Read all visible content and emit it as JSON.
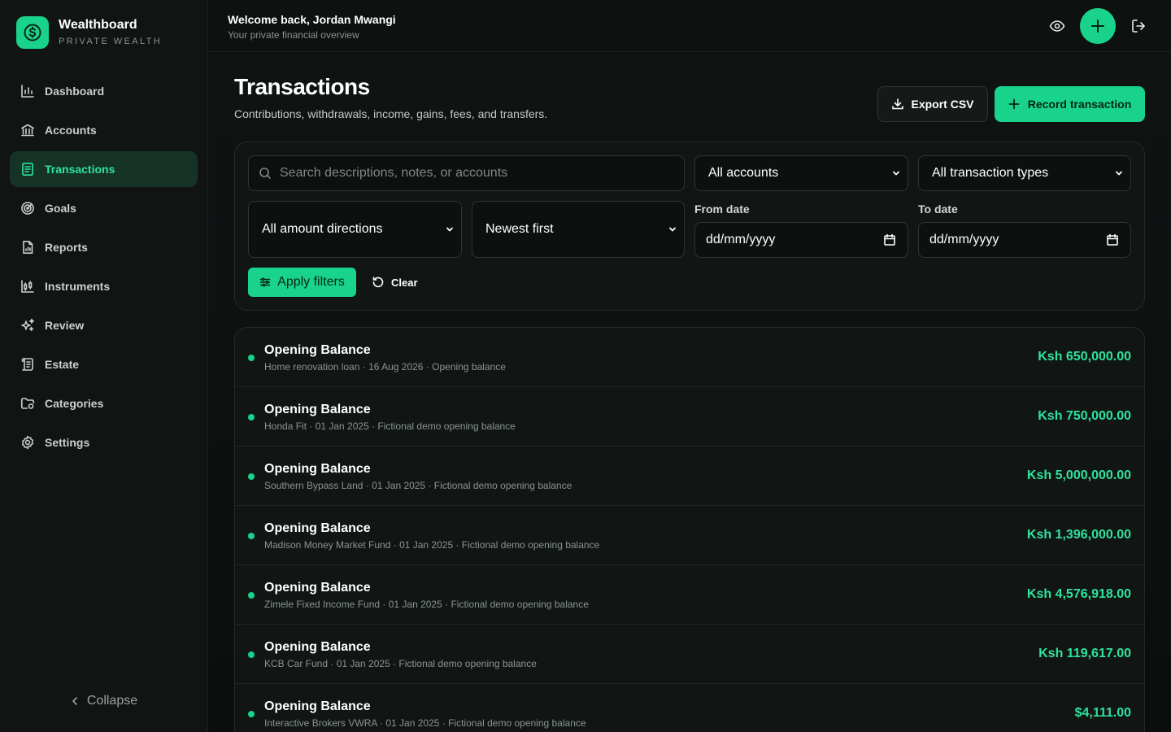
{
  "brand": {
    "name": "Wealthboard",
    "subtitle": "PRIVATE WEALTH"
  },
  "sidebar": {
    "items": [
      {
        "label": "Dashboard",
        "icon": "bar-chart-icon",
        "active": false
      },
      {
        "label": "Accounts",
        "icon": "bank-icon",
        "active": false
      },
      {
        "label": "Transactions",
        "icon": "receipt-icon",
        "active": true
      },
      {
        "label": "Goals",
        "icon": "target-icon",
        "active": false
      },
      {
        "label": "Reports",
        "icon": "report-icon",
        "active": false
      },
      {
        "label": "Instruments",
        "icon": "candlestick-icon",
        "active": false
      },
      {
        "label": "Review",
        "icon": "sparkles-icon",
        "active": false
      },
      {
        "label": "Estate",
        "icon": "scroll-icon",
        "active": false
      },
      {
        "label": "Categories",
        "icon": "folder-icon",
        "active": false
      },
      {
        "label": "Settings",
        "icon": "gear-icon",
        "active": false
      }
    ],
    "collapse_label": "Collapse"
  },
  "header": {
    "welcome": "Welcome back, Jordan Mwangi",
    "subtitle": "Your private financial overview"
  },
  "page": {
    "title": "Transactions",
    "subtitle": "Contributions, withdrawals, income, gains, fees, and transfers.",
    "export_label": "Export CSV",
    "record_label": "Record transaction"
  },
  "filters": {
    "search_placeholder": "Search descriptions, notes, or accounts",
    "accounts": "All accounts",
    "types": "All transaction types",
    "directions": "All amount directions",
    "sort": "Newest first",
    "from_label": "From date",
    "to_label": "To date",
    "from_value": "dd/mm/yyyy",
    "to_value": "dd/mm/yyyy",
    "apply_label": "Apply filters",
    "clear_label": "Clear"
  },
  "transactions": [
    {
      "title": "Opening Balance",
      "meta": "Home renovation loan · 16 Aug 2026 · Opening balance",
      "amount": "Ksh 650,000.00"
    },
    {
      "title": "Opening Balance",
      "meta": "Honda Fit · 01 Jan 2025 · Fictional demo opening balance",
      "amount": "Ksh 750,000.00"
    },
    {
      "title": "Opening Balance",
      "meta": "Southern Bypass Land · 01 Jan 2025 · Fictional demo opening balance",
      "amount": "Ksh 5,000,000.00"
    },
    {
      "title": "Opening Balance",
      "meta": "Madison Money Market Fund · 01 Jan 2025 · Fictional demo opening balance",
      "amount": "Ksh 1,396,000.00"
    },
    {
      "title": "Opening Balance",
      "meta": "Zimele Fixed Income Fund · 01 Jan 2025 · Fictional demo opening balance",
      "amount": "Ksh 4,576,918.00"
    },
    {
      "title": "Opening Balance",
      "meta": "KCB Car Fund · 01 Jan 2025 · Fictional demo opening balance",
      "amount": "Ksh 119,617.00"
    },
    {
      "title": "Opening Balance",
      "meta": "Interactive Brokers VWRA · 01 Jan 2025 · Fictional demo opening balance",
      "amount": "$4,111.00"
    }
  ],
  "colors": {
    "accent": "#19d38c",
    "accent_text": "#2fe39e",
    "background": "#0c0f0e",
    "active_nav_bg": "#153327"
  }
}
